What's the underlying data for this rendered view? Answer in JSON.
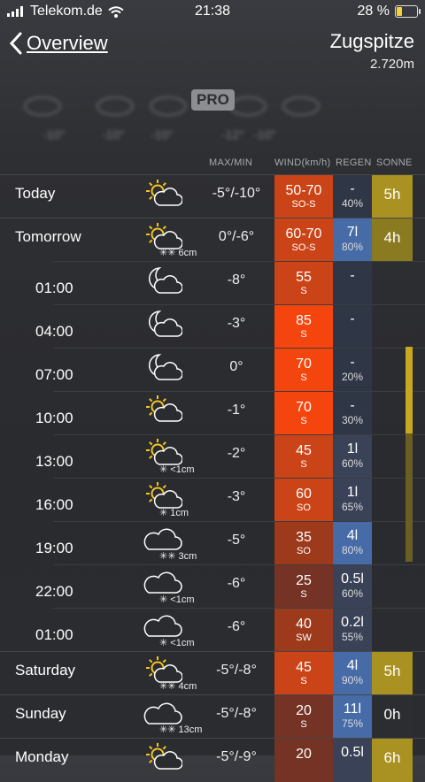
{
  "status": {
    "carrier": "Telekom.de",
    "time": "21:38",
    "battery": "28 %"
  },
  "nav": {
    "back_label": "Overview",
    "title": "Zugspitze",
    "subtitle": "2.720m"
  },
  "pro_badge": "PRO",
  "blurred_temps": [
    "-10°",
    "-10°",
    "-10°",
    "-12°",
    "-10°"
  ],
  "headers": {
    "maxmin": "MAX/MIN",
    "wind": "WIND(km/h)",
    "rain": "REGEN",
    "sun": "SONNE"
  },
  "colors": {
    "wind_strong": "#f5450f",
    "wind_medium": "#cb4417",
    "wind_low": "#9d3a1c",
    "wind_weak": "#743324",
    "rain_none": "#2f3645",
    "rain_light": "#3a4258",
    "rain_heavy": "#466ba6",
    "sun_strong": "#a99222",
    "sun_mid": "#8a7b20",
    "sun_none": "#2c2d31"
  },
  "days": [
    {
      "label": "Today",
      "icon": "sun-cloud-icon",
      "snow": "",
      "max": "-5°",
      "min": "-10°",
      "wind": "50-70",
      "dir": "SO-S",
      "rain": "-",
      "rain_pct": "40%",
      "sun": "5h"
    },
    {
      "label": "Tomorrow",
      "icon": "sun-cloud-icon",
      "snow": "6cm",
      "max": "0°",
      "min": "-6°",
      "wind": "60-70",
      "dir": "SO-S",
      "rain": "7l",
      "rain_pct": "80%",
      "sun": "4h"
    },
    {
      "label": "Saturday",
      "icon": "sun-cloud-icon",
      "snow": "4cm",
      "max": "-5°",
      "min": "-8°",
      "wind": "45",
      "dir": "S",
      "rain": "4l",
      "rain_pct": "90%",
      "sun": "5h"
    },
    {
      "label": "Sunday",
      "icon": "cloud-icon",
      "snow": "13cm",
      "max": "-5°",
      "min": "-8°",
      "wind": "20",
      "dir": "S",
      "rain": "11l",
      "rain_pct": "75%",
      "sun": "0h"
    },
    {
      "label": "Monday",
      "icon": "sun-cloud-icon",
      "snow": "",
      "max": "-5°",
      "min": "-9°",
      "wind": "20",
      "dir": "",
      "rain": "0.5l",
      "rain_pct": "",
      "sun": "6h"
    }
  ],
  "hours": [
    {
      "time": "01:00",
      "icon": "moon-cloud-icon",
      "snow": "",
      "temp": "-8°",
      "wind": "55",
      "dir": "S",
      "rain": "-",
      "rain_pct": ""
    },
    {
      "time": "04:00",
      "icon": "moon-cloud-icon",
      "snow": "",
      "temp": "-3°",
      "wind": "85",
      "dir": "S",
      "rain": "-",
      "rain_pct": ""
    },
    {
      "time": "07:00",
      "icon": "moon-cloud-icon",
      "snow": "",
      "temp": "0°",
      "wind": "70",
      "dir": "S",
      "rain": "-",
      "rain_pct": "20%"
    },
    {
      "time": "10:00",
      "icon": "sun-cloud-icon",
      "snow": "",
      "temp": "-1°",
      "wind": "70",
      "dir": "S",
      "rain": "-",
      "rain_pct": "30%"
    },
    {
      "time": "13:00",
      "icon": "sun-cloud-icon",
      "snow": "<1cm",
      "temp": "-2°",
      "wind": "45",
      "dir": "S",
      "rain": "1l",
      "rain_pct": "60%"
    },
    {
      "time": "16:00",
      "icon": "sun-cloud-icon",
      "snow": "1cm",
      "temp": "-3°",
      "wind": "60",
      "dir": "SO",
      "rain": "1l",
      "rain_pct": "65%"
    },
    {
      "time": "19:00",
      "icon": "cloud-icon",
      "snow": "3cm",
      "temp": "-5°",
      "wind": "35",
      "dir": "SO",
      "rain": "4l",
      "rain_pct": "80%"
    },
    {
      "time": "22:00",
      "icon": "cloud-icon",
      "snow": "<1cm",
      "temp": "-6°",
      "wind": "25",
      "dir": "S",
      "rain": "0.5l",
      "rain_pct": "60%"
    },
    {
      "time": "01:00",
      "icon": "cloud-icon",
      "snow": "<1cm",
      "temp": "-6°",
      "wind": "40",
      "dir": "SW",
      "rain": "0.2l",
      "rain_pct": "55%"
    }
  ]
}
